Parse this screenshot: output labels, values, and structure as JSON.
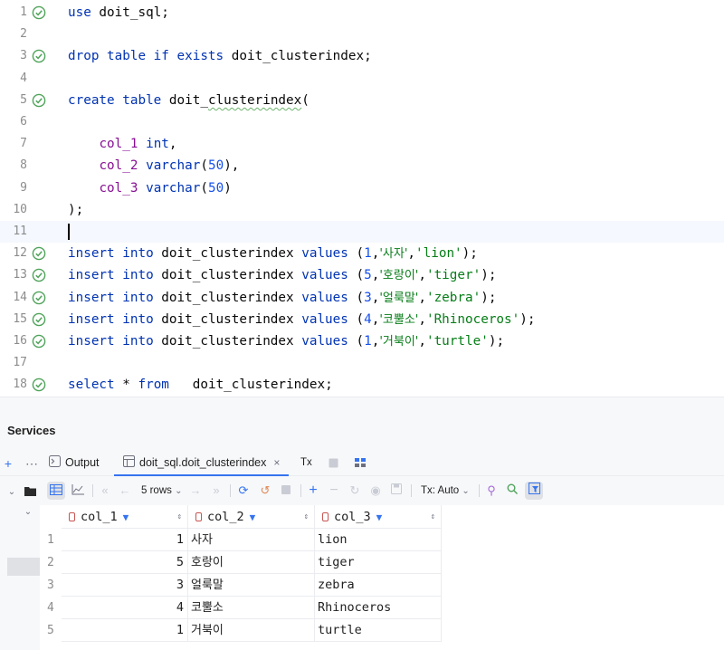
{
  "editor": {
    "current_line_index": 10,
    "lines": [
      {
        "n": "1",
        "check": true,
        "tokens": [
          [
            "kw",
            "use"
          ],
          [
            "plain",
            " doit_sql;"
          ]
        ]
      },
      {
        "n": "2",
        "check": false,
        "tokens": []
      },
      {
        "n": "3",
        "check": true,
        "tokens": [
          [
            "kw",
            "drop table if exists"
          ],
          [
            "plain",
            " doit_clusterindex;"
          ]
        ]
      },
      {
        "n": "4",
        "check": false,
        "tokens": []
      },
      {
        "n": "5",
        "check": true,
        "tokens": [
          [
            "kw",
            "create table"
          ],
          [
            "plain",
            " doit_"
          ],
          [
            "squig",
            "clusterindex"
          ],
          [
            "plain",
            "("
          ]
        ]
      },
      {
        "n": "6",
        "check": false,
        "tokens": []
      },
      {
        "n": "7",
        "check": false,
        "tokens": [
          [
            "plain",
            "    "
          ],
          [
            "col",
            "col_1"
          ],
          [
            "plain",
            " "
          ],
          [
            "kw",
            "int"
          ],
          [
            "plain",
            ","
          ]
        ]
      },
      {
        "n": "8",
        "check": false,
        "tokens": [
          [
            "plain",
            "    "
          ],
          [
            "col",
            "col_2"
          ],
          [
            "plain",
            " "
          ],
          [
            "kw",
            "varchar"
          ],
          [
            "plain",
            "("
          ],
          [
            "num",
            "50"
          ],
          [
            "plain",
            "),"
          ]
        ]
      },
      {
        "n": "9",
        "check": false,
        "tokens": [
          [
            "plain",
            "    "
          ],
          [
            "col",
            "col_3"
          ],
          [
            "plain",
            " "
          ],
          [
            "kw",
            "varchar"
          ],
          [
            "plain",
            "("
          ],
          [
            "num",
            "50"
          ],
          [
            "plain",
            ")"
          ]
        ]
      },
      {
        "n": "10",
        "check": false,
        "tokens": [
          [
            "plain",
            ");"
          ]
        ]
      },
      {
        "n": "11",
        "check": false,
        "tokens": []
      },
      {
        "n": "12",
        "check": true,
        "tokens": [
          [
            "kw",
            "insert into"
          ],
          [
            "plain",
            " doit_clusterindex "
          ],
          [
            "kw",
            "values"
          ],
          [
            "plain",
            " ("
          ],
          [
            "num",
            "1"
          ],
          [
            "plain",
            ","
          ],
          [
            "str",
            "'사자'"
          ],
          [
            "plain",
            ","
          ],
          [
            "str",
            "'lion'"
          ],
          [
            "plain",
            ");"
          ]
        ]
      },
      {
        "n": "13",
        "check": true,
        "tokens": [
          [
            "kw",
            "insert into"
          ],
          [
            "plain",
            " doit_clusterindex "
          ],
          [
            "kw",
            "values"
          ],
          [
            "plain",
            " ("
          ],
          [
            "num",
            "5"
          ],
          [
            "plain",
            ","
          ],
          [
            "str",
            "'호랑이'"
          ],
          [
            "plain",
            ","
          ],
          [
            "str",
            "'tiger'"
          ],
          [
            "plain",
            ");"
          ]
        ]
      },
      {
        "n": "14",
        "check": true,
        "tokens": [
          [
            "kw",
            "insert into"
          ],
          [
            "plain",
            " doit_clusterindex "
          ],
          [
            "kw",
            "values"
          ],
          [
            "plain",
            " ("
          ],
          [
            "num",
            "3"
          ],
          [
            "plain",
            ","
          ],
          [
            "str",
            "'얼룩말'"
          ],
          [
            "plain",
            ","
          ],
          [
            "str",
            "'zebra'"
          ],
          [
            "plain",
            ");"
          ]
        ]
      },
      {
        "n": "15",
        "check": true,
        "tokens": [
          [
            "kw",
            "insert into"
          ],
          [
            "plain",
            " doit_clusterindex "
          ],
          [
            "kw",
            "values"
          ],
          [
            "plain",
            " ("
          ],
          [
            "num",
            "4"
          ],
          [
            "plain",
            ","
          ],
          [
            "str",
            "'코뿔소'"
          ],
          [
            "plain",
            ","
          ],
          [
            "str",
            "'Rhinoceros'"
          ],
          [
            "plain",
            ");"
          ]
        ]
      },
      {
        "n": "16",
        "check": true,
        "tokens": [
          [
            "kw",
            "insert into"
          ],
          [
            "plain",
            " doit_clusterindex "
          ],
          [
            "kw",
            "values"
          ],
          [
            "plain",
            " ("
          ],
          [
            "num",
            "1"
          ],
          [
            "plain",
            ","
          ],
          [
            "str",
            "'거북이'"
          ],
          [
            "plain",
            ","
          ],
          [
            "str",
            "'turtle'"
          ],
          [
            "plain",
            ");"
          ]
        ]
      },
      {
        "n": "17",
        "check": false,
        "tokens": []
      },
      {
        "n": "18",
        "check": true,
        "tokens": [
          [
            "kw",
            "select"
          ],
          [
            "plain",
            " * "
          ],
          [
            "kw",
            "from"
          ],
          [
            "plain",
            "   doit_clusterindex;"
          ]
        ]
      }
    ]
  },
  "services": {
    "title": "Services",
    "tabs": {
      "output_label": "Output",
      "table_label": "doit_sql.doit_clusterindex",
      "close_glyph": "×",
      "tx_label": "Tx"
    },
    "toolbar": {
      "rows_label": "5 rows",
      "tx_mode_label": "Tx: Auto"
    },
    "grid": {
      "columns": [
        "col_1",
        "col_2",
        "col_3"
      ],
      "rows": [
        {
          "n": "1",
          "col_1": "1",
          "col_2": "사자",
          "col_3": "lion"
        },
        {
          "n": "2",
          "col_1": "5",
          "col_2": "호랑이",
          "col_3": "tiger"
        },
        {
          "n": "3",
          "col_1": "3",
          "col_2": "얼룩말",
          "col_3": "zebra"
        },
        {
          "n": "4",
          "col_1": "4",
          "col_2": "코뿔소",
          "col_3": "Rhinoceros"
        },
        {
          "n": "5",
          "col_1": "1",
          "col_2": "거북이",
          "col_3": "turtle"
        }
      ]
    }
  },
  "colors": {
    "keyword": "#0033b3",
    "column": "#871094",
    "number": "#1750eb",
    "string": "#067d17",
    "accent": "#3574f0",
    "check": "#4fa35a"
  }
}
